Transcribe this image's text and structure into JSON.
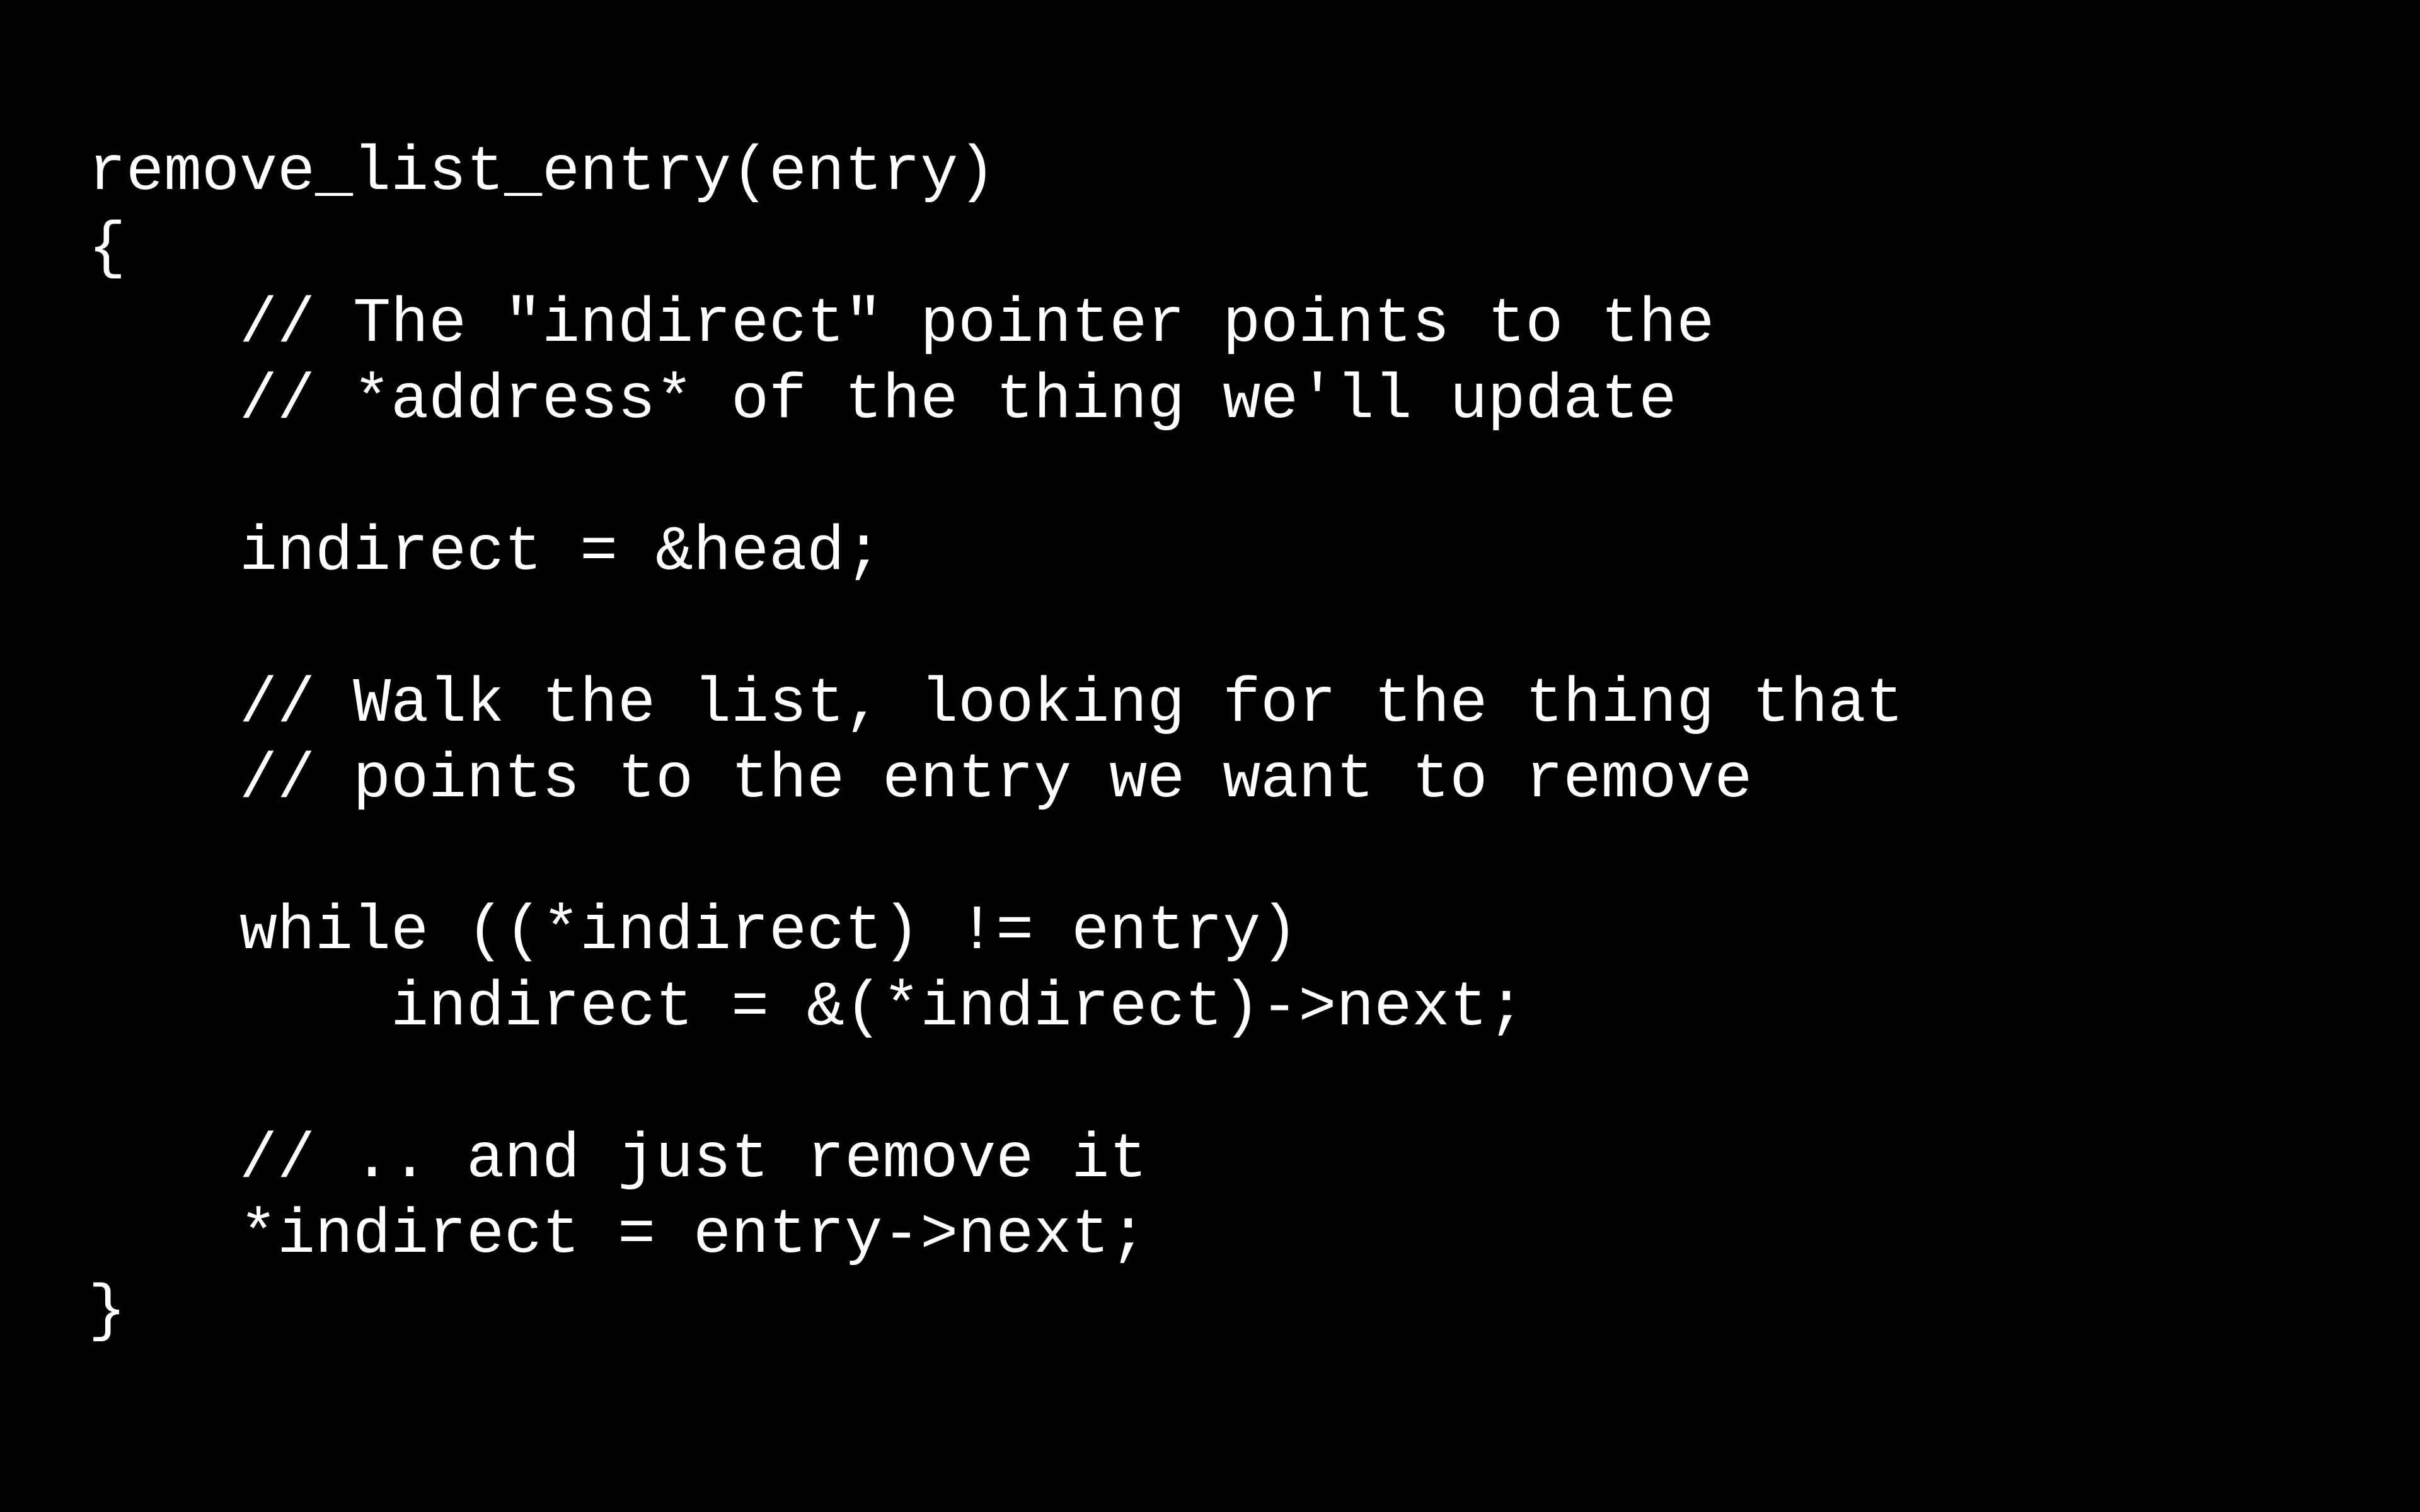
{
  "code": {
    "lines": [
      "remove_list_entry(entry)",
      "{",
      "    // The \"indirect\" pointer points to the",
      "    // *address* of the thing we'll update",
      "",
      "    indirect = &head;",
      "",
      "    // Walk the list, looking for the thing that",
      "    // points to the entry we want to remove",
      "",
      "    while ((*indirect) != entry)",
      "        indirect = &(*indirect)->next;",
      "",
      "    // .. and just remove it",
      "    *indirect = entry->next;",
      "}"
    ]
  }
}
